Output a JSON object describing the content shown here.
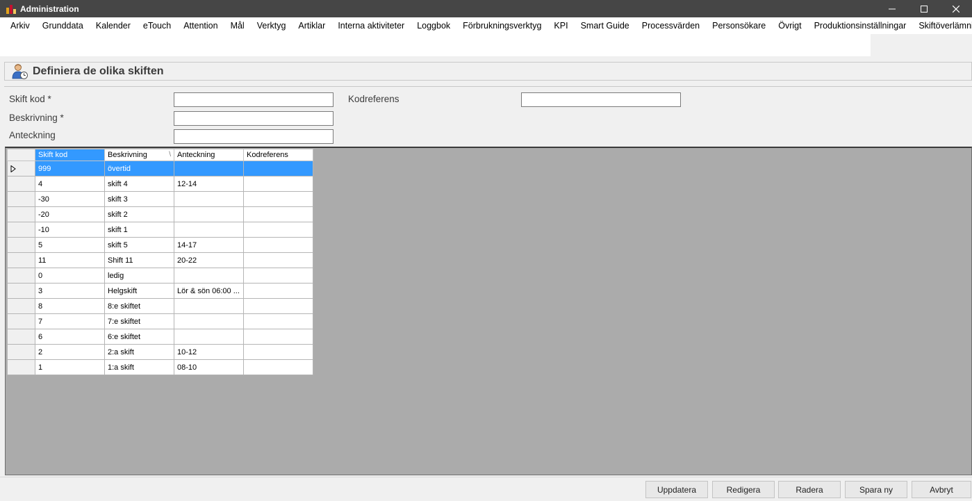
{
  "window": {
    "title": "Administration"
  },
  "menu": [
    "Arkiv",
    "Grunddata",
    "Kalender",
    "eTouch",
    "Attention",
    "Mål",
    "Verktyg",
    "Artiklar",
    "Interna aktiviteter",
    "Loggbok",
    "Förbrukningsverktyg",
    "KPI",
    "Smart Guide",
    "Processvärden",
    "Personsökare",
    "Övrigt",
    "Produktionsinställningar",
    "Skiftöverlämning"
  ],
  "page": {
    "title": "Definiera de olika skiften",
    "icon": "user-clock-icon"
  },
  "form": {
    "skift_kod": {
      "label": "Skift kod",
      "required_mark": "*",
      "value": ""
    },
    "beskrivning": {
      "label": "Beskrivning",
      "required_mark": "*",
      "value": ""
    },
    "anteckning": {
      "label": "Anteckning",
      "value": ""
    },
    "kodreferens": {
      "label": "Kodreferens",
      "value": ""
    }
  },
  "grid": {
    "columns": [
      "Skift kod",
      "Beskrivning",
      "Anteckning",
      "Kodreferens"
    ],
    "sort_mark": "\\",
    "rows": [
      {
        "kod": "999",
        "beskrivning": "övertid",
        "anteckning": "",
        "kodreferens": "",
        "selected": true
      },
      {
        "kod": "4",
        "beskrivning": "skift 4",
        "anteckning": "12-14",
        "kodreferens": ""
      },
      {
        "kod": "-30",
        "beskrivning": "skift 3",
        "anteckning": "",
        "kodreferens": ""
      },
      {
        "kod": "-20",
        "beskrivning": "skift 2",
        "anteckning": "",
        "kodreferens": ""
      },
      {
        "kod": "-10",
        "beskrivning": "skift 1",
        "anteckning": "",
        "kodreferens": ""
      },
      {
        "kod": "5",
        "beskrivning": "skift  5",
        "anteckning": "14-17",
        "kodreferens": ""
      },
      {
        "kod": "11",
        "beskrivning": "Shift 11",
        "anteckning": "20-22",
        "kodreferens": ""
      },
      {
        "kod": "0",
        "beskrivning": "ledig",
        "anteckning": "",
        "kodreferens": ""
      },
      {
        "kod": "3",
        "beskrivning": "Helgskift",
        "anteckning": "Lör & sön 06:00 ...",
        "kodreferens": ""
      },
      {
        "kod": "8",
        "beskrivning": "8:e skiftet",
        "anteckning": "",
        "kodreferens": ""
      },
      {
        "kod": "7",
        "beskrivning": "7:e skiftet",
        "anteckning": "",
        "kodreferens": ""
      },
      {
        "kod": "6",
        "beskrivning": "6:e skiftet",
        "anteckning": "",
        "kodreferens": ""
      },
      {
        "kod": "2",
        "beskrivning": "2:a skift",
        "anteckning": "10-12",
        "kodreferens": ""
      },
      {
        "kod": "1",
        "beskrivning": "1:a skift",
        "anteckning": "08-10",
        "kodreferens": ""
      }
    ]
  },
  "buttons": {
    "update": "Uppdatera",
    "edit": "Redigera",
    "delete": "Radera",
    "save_new": "Spara ny",
    "cancel": "Avbryt"
  },
  "colors": {
    "titlebar": "#464646",
    "selection": "#3399ff",
    "grid_background": "#ababab"
  }
}
